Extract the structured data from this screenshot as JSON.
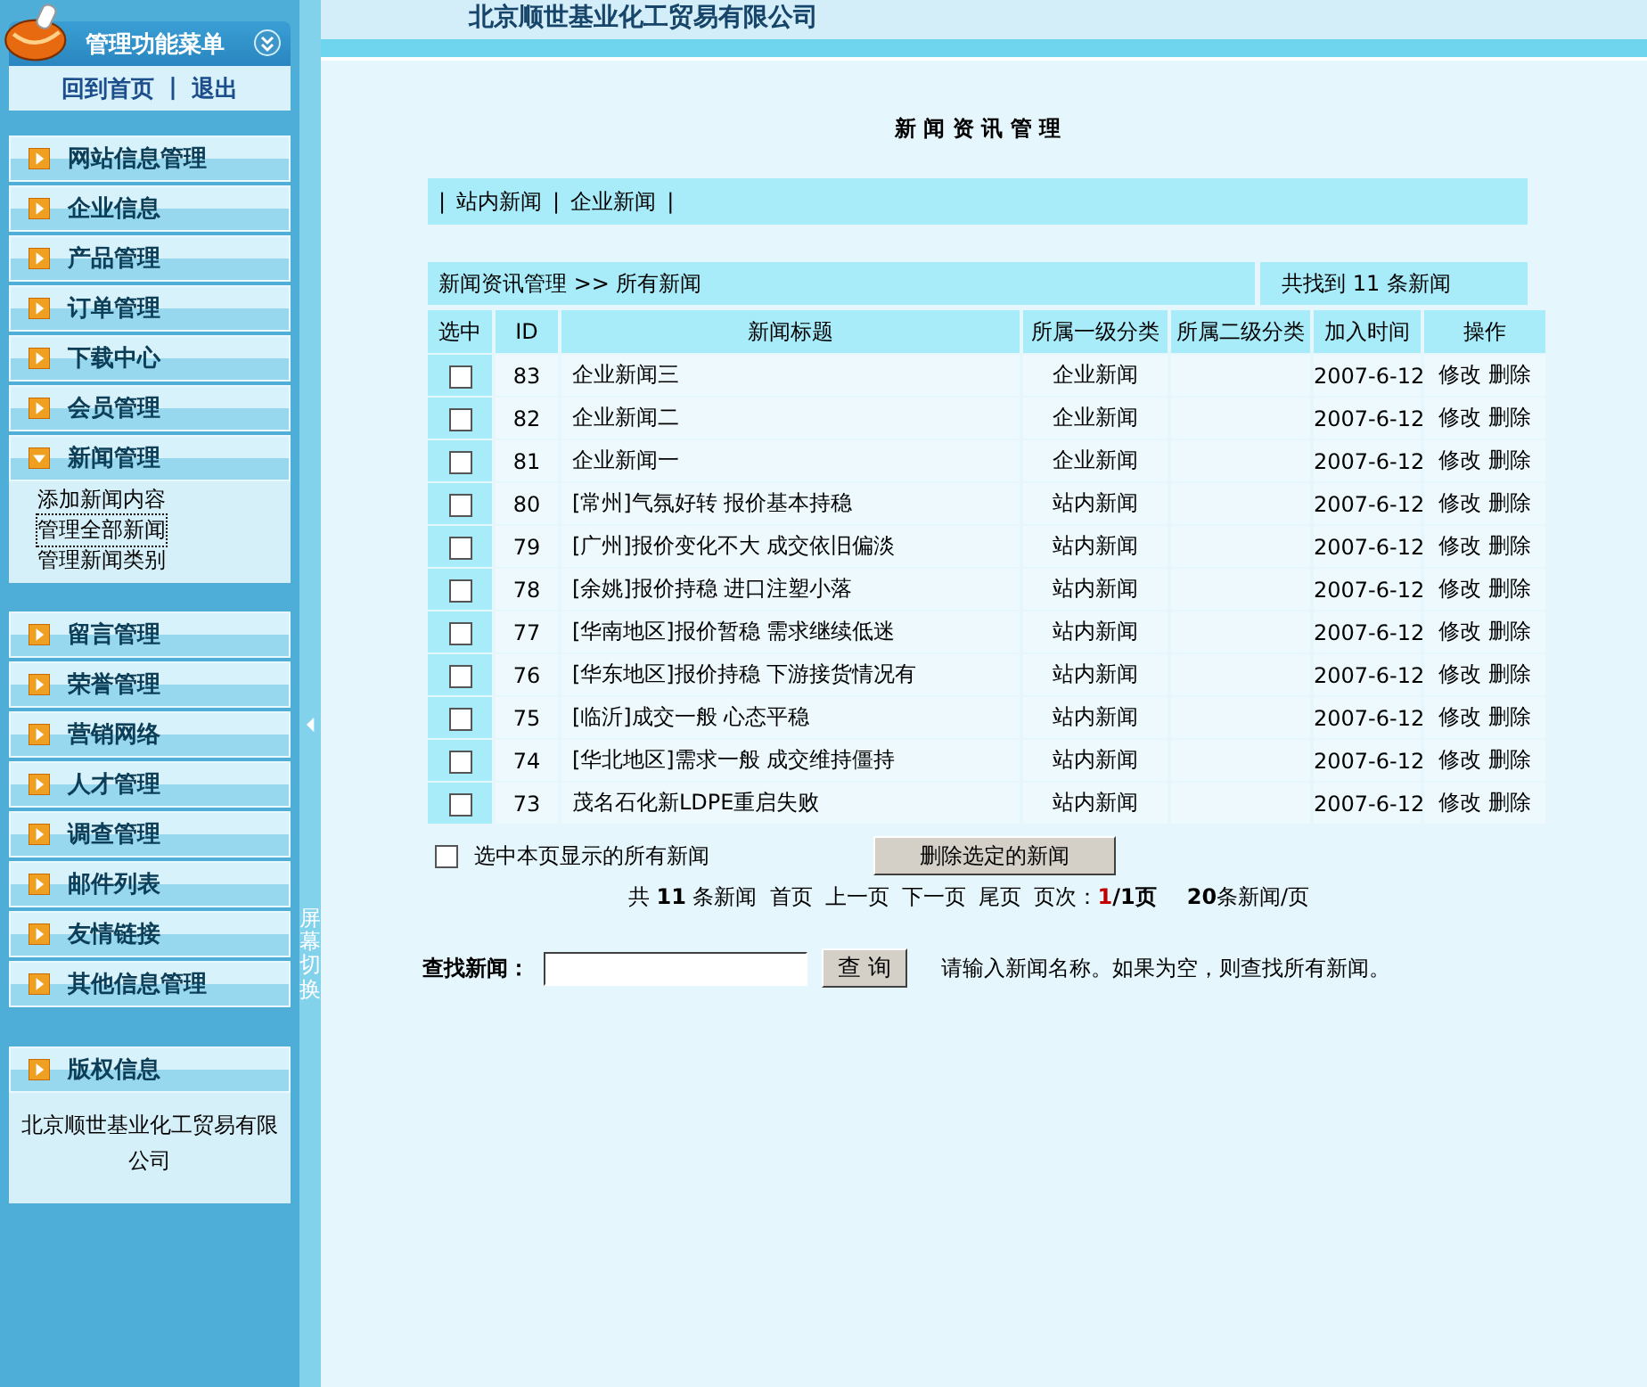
{
  "sidebar": {
    "title": "管理功能菜单",
    "links": [
      "回到首页",
      "退出"
    ],
    "separator": "|",
    "groups": [
      {
        "label": "网站信息管理",
        "expanded": false
      },
      {
        "label": "企业信息",
        "expanded": false
      },
      {
        "label": "产品管理",
        "expanded": false
      },
      {
        "label": "订单管理",
        "expanded": false
      },
      {
        "label": "下载中心",
        "expanded": false
      },
      {
        "label": "会员管理",
        "expanded": false
      },
      {
        "label": "新闻管理",
        "expanded": true,
        "children": [
          {
            "label": "添加新闻内容",
            "selected": false
          },
          {
            "label": "管理全部新闻",
            "selected": true
          },
          {
            "label": "管理新闻类别",
            "selected": false
          }
        ]
      }
    ],
    "groups2": [
      {
        "label": "留言管理",
        "expanded": false
      },
      {
        "label": "荣誉管理",
        "expanded": false
      },
      {
        "label": "营销网络",
        "expanded": false
      },
      {
        "label": "人才管理",
        "expanded": false
      },
      {
        "label": "调查管理",
        "expanded": false
      },
      {
        "label": "邮件列表",
        "expanded": false
      },
      {
        "label": "友情链接",
        "expanded": false
      },
      {
        "label": "其他信息管理",
        "expanded": false
      }
    ],
    "copyright": {
      "title": "版权信息",
      "text": "北京顺世基业化工贸易有限公司"
    }
  },
  "splitter": {
    "label": "屏幕切换"
  },
  "header": {
    "company": "北京顺世基业化工贸易有限公司"
  },
  "page_title": "新 闻 资 讯 管 理",
  "category_bar": {
    "separator": "|",
    "links": [
      "站内新闻",
      "企业新闻"
    ]
  },
  "breadcrumb": "新闻资讯管理 >> 所有新闻",
  "found": "共找到 11 条新闻",
  "table": {
    "columns": [
      "选中",
      "ID",
      "新闻标题",
      "所属一级分类",
      "所属二级分类",
      "加入时间",
      "操作"
    ],
    "rows": [
      {
        "checked": false,
        "id": "83",
        "title": "企业新闻三",
        "category1": "企业新闻",
        "date": "2007-6-12",
        "edit": "修改",
        "delete": "删除"
      },
      {
        "checked": false,
        "id": "82",
        "title": "企业新闻二",
        "category1": "企业新闻",
        "date": "2007-6-12",
        "edit": "修改",
        "delete": "删除"
      },
      {
        "checked": false,
        "id": "81",
        "title": "企业新闻一",
        "category1": "企业新闻",
        "date": "2007-6-12",
        "edit": "修改",
        "delete": "删除"
      },
      {
        "checked": false,
        "id": "80",
        "title": "[常州]气氛好转 报价基本持稳",
        "category1": "站内新闻",
        "date": "2007-6-12",
        "edit": "修改",
        "delete": "删除"
      },
      {
        "checked": false,
        "id": "79",
        "title": "[广州]报价变化不大 成交依旧偏淡",
        "category1": "站内新闻",
        "date": "2007-6-12",
        "edit": "修改",
        "delete": "删除"
      },
      {
        "checked": false,
        "id": "78",
        "title": "[余姚]报价持稳 进口注塑小落",
        "category1": "站内新闻",
        "date": "2007-6-12",
        "edit": "修改",
        "delete": "删除"
      },
      {
        "checked": false,
        "id": "77",
        "title": "[华南地区]报价暂稳 需求继续低迷",
        "category1": "站内新闻",
        "date": "2007-6-12",
        "edit": "修改",
        "delete": "删除"
      },
      {
        "checked": false,
        "id": "76",
        "title": "[华东地区]报价持稳 下游接货情况有",
        "category1": "站内新闻",
        "date": "2007-6-12",
        "edit": "修改",
        "delete": "删除"
      },
      {
        "checked": false,
        "id": "75",
        "title": "[临沂]成交一般 心态平稳",
        "category1": "站内新闻",
        "date": "2007-6-12",
        "edit": "修改",
        "delete": "删除"
      },
      {
        "checked": false,
        "id": "74",
        "title": "[华北地区]需求一般 成交维持僵持",
        "category1": "站内新闻",
        "date": "2007-6-12",
        "edit": "修改",
        "delete": "删除"
      },
      {
        "checked": false,
        "id": "73",
        "title": "茂名石化新LDPE重启失败",
        "category1": "站内新闻",
        "date": "2007-6-12",
        "edit": "修改",
        "delete": "删除"
      }
    ]
  },
  "select_all": {
    "label": "选中本页显示的所有新闻",
    "checked": false
  },
  "delete_button": "删除选定的新闻",
  "pagination": {
    "total": "共 **11** 条新闻",
    "links": [
      "首页",
      "上一页",
      "下一页",
      "尾页"
    ],
    "page_label": "页次：",
    "current_page": "1",
    "total_pages": "/1页",
    "per_page": "**20**条新闻/页"
  },
  "search": {
    "label": "查找新闻：",
    "button": "查 询",
    "hint": "请输入新闻名称。如果为空，则查找所有新闻。"
  }
}
